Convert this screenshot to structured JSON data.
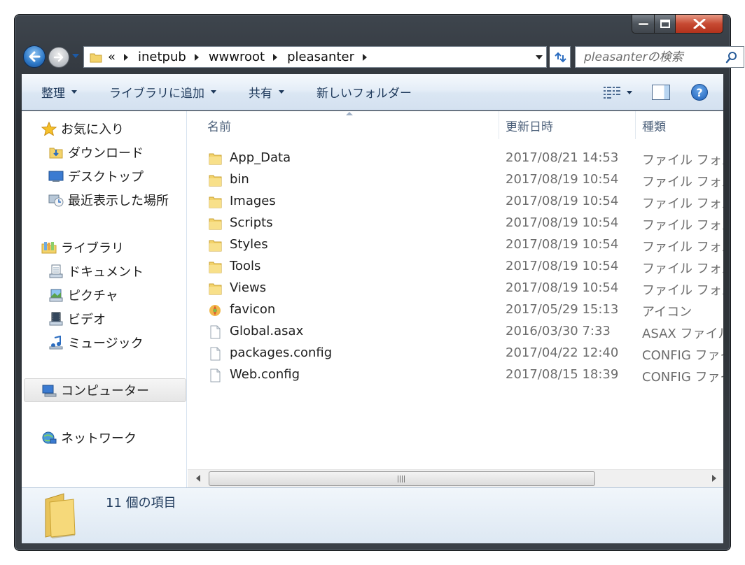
{
  "window": {
    "caption_buttons": [
      "minimize-icon",
      "maximize-icon",
      "close-icon"
    ]
  },
  "nav": {
    "breadcrumb_overflow": "«",
    "breadcrumbs": [
      "inetpub",
      "wwwroot",
      "pleasanter"
    ],
    "search_placeholder": "pleasanterの検索"
  },
  "toolbar": {
    "organize": "整理",
    "include_library": "ライブラリに追加",
    "share": "共有",
    "new_folder": "新しいフォルダー"
  },
  "sidebar": {
    "favorites": {
      "label": "お気に入り",
      "items": [
        "ダウンロード",
        "デスクトップ",
        "最近表示した場所"
      ]
    },
    "libraries": {
      "label": "ライブラリ",
      "items": [
        "ドキュメント",
        "ピクチャ",
        "ビデオ",
        "ミュージック"
      ]
    },
    "computer": "コンピューター",
    "network": "ネットワーク"
  },
  "columns": {
    "name": "名前",
    "date": "更新日時",
    "type": "種類"
  },
  "files": [
    {
      "name": "App_Data",
      "date": "2017/08/21 14:53",
      "type": "ファイル フォルダー",
      "icon": "folder-icon"
    },
    {
      "name": "bin",
      "date": "2017/08/19 10:54",
      "type": "ファイル フォルダー",
      "icon": "folder-icon"
    },
    {
      "name": "Images",
      "date": "2017/08/19 10:54",
      "type": "ファイル フォルダー",
      "icon": "folder-icon"
    },
    {
      "name": "Scripts",
      "date": "2017/08/19 10:54",
      "type": "ファイル フォルダー",
      "icon": "folder-icon"
    },
    {
      "name": "Styles",
      "date": "2017/08/19 10:54",
      "type": "ファイル フォルダー",
      "icon": "folder-icon"
    },
    {
      "name": "Tools",
      "date": "2017/08/19 10:54",
      "type": "ファイル フォルダー",
      "icon": "folder-icon"
    },
    {
      "name": "Views",
      "date": "2017/08/19 10:54",
      "type": "ファイル フォルダー",
      "icon": "folder-icon"
    },
    {
      "name": "favicon",
      "date": "2017/05/29 15:13",
      "type": "アイコン",
      "icon": "favicon-icon"
    },
    {
      "name": "Global.asax",
      "date": "2016/03/30 7:33",
      "type": "ASAX ファイル",
      "icon": "file-icon"
    },
    {
      "name": "packages.config",
      "date": "2017/04/22 12:40",
      "type": "CONFIG ファイル",
      "icon": "file-icon"
    },
    {
      "name": "Web.config",
      "date": "2017/08/15 18:39",
      "type": "CONFIG ファイル",
      "icon": "file-icon"
    }
  ],
  "details": {
    "count_text": "11 個の項目"
  },
  "colors": {
    "toolbar_text": "#1e395b",
    "folder_yellow": "#f3d36b",
    "accent_blue": "#2c77c6"
  }
}
